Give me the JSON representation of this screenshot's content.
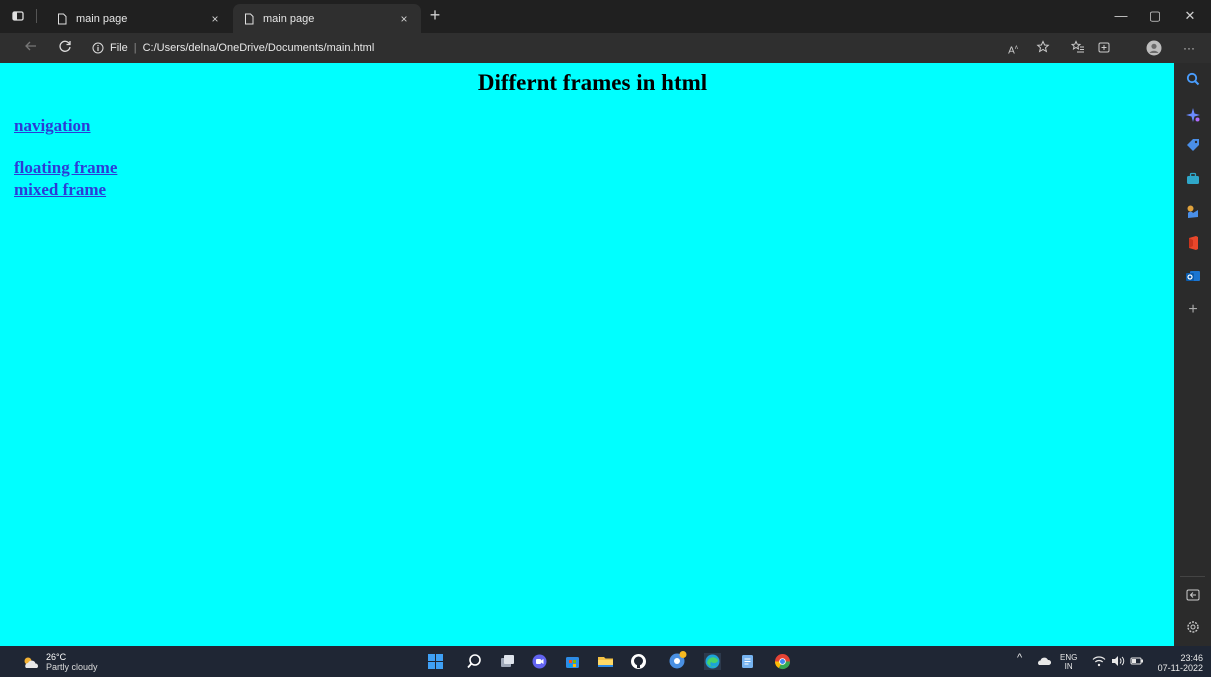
{
  "browser": {
    "tabs": [
      {
        "title": "main page",
        "close": "×"
      },
      {
        "title": "main page",
        "close": "×"
      }
    ],
    "new_tab": "+",
    "window_controls": {
      "minimize": "—",
      "restore": "▢",
      "close": "✕"
    },
    "address": {
      "scheme_label": "File",
      "separator": "|",
      "url": "C:/Users/delna/OneDrive/Documents/main.html"
    },
    "toolbar_icons": [
      "read-aloud-icon",
      "favorite-icon",
      "favorites-list-icon",
      "collections-icon",
      "profile-icon",
      "more-icon"
    ],
    "more_label": "···"
  },
  "page": {
    "heading": "Differnt frames in html",
    "links": [
      "navigation",
      "floating frame",
      "mixed frame"
    ],
    "background": "#00ffff",
    "link_color": "#2c3bd6"
  },
  "sidebar": {
    "icons": [
      "search-icon",
      "copilot-icon",
      "shopping-tag-icon",
      "tools-icon",
      "games-icon",
      "office-icon",
      "outlook-icon",
      "add-icon",
      "hide-sidebar-icon",
      "settings-icon"
    ],
    "add_label": "+"
  },
  "taskbar": {
    "weather": {
      "temp": "26°C",
      "desc": "Partly cloudy"
    },
    "apps": [
      "windows-start-icon",
      "search-icon",
      "task-view-icon",
      "teams-chat-icon",
      "microsoft-store-icon",
      "file-explorer-icon",
      "github-icon",
      "chrome-canary-icon",
      "edge-icon",
      "notepad-icon",
      "chrome-icon"
    ],
    "tray": {
      "chevron": "^",
      "lang_top": "ENG",
      "lang_bottom": "IN"
    },
    "clock": {
      "time": "23:46",
      "date": "07-11-2022"
    }
  }
}
